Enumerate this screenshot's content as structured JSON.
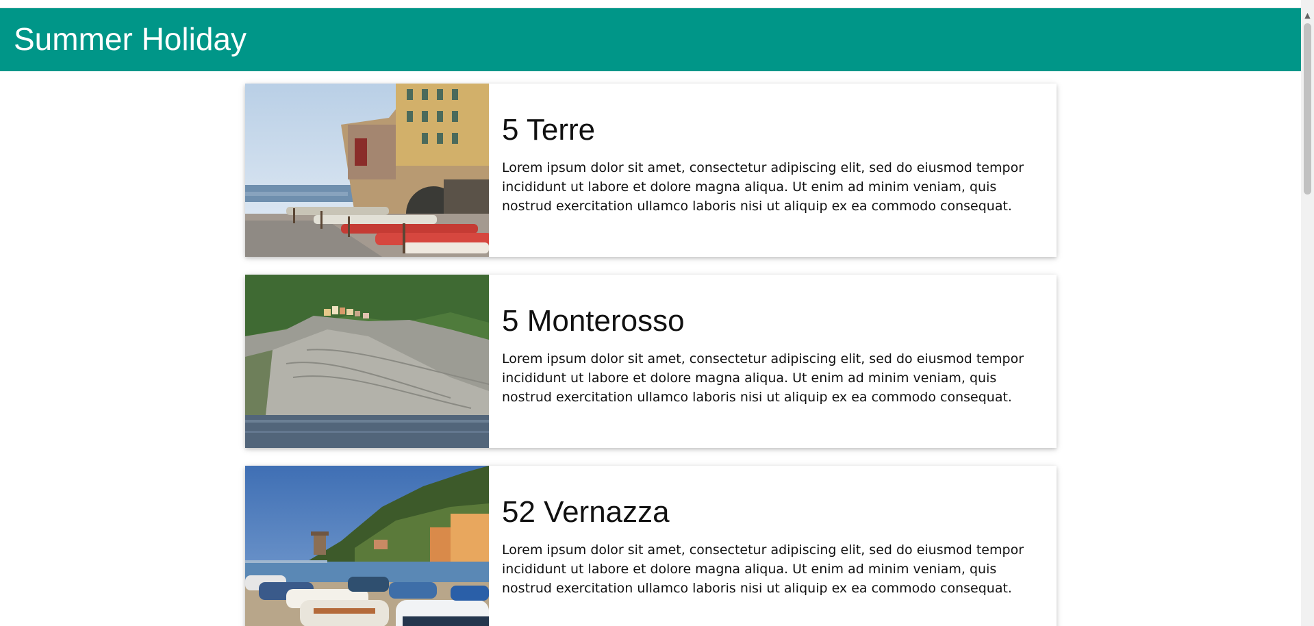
{
  "header": {
    "title": "Summer Holiday",
    "color": "#009688"
  },
  "cards": [
    {
      "title": "5 Terre",
      "text": "Lorem ipsum dolor sit amet, consectetur adipiscing elit, sed do eiusmod tempor incididunt ut labore et dolore magna aliqua. Ut enim ad minim veniam, quis nostrud exercitation ullamco laboris nisi ut aliquip ex ea commodo consequat."
    },
    {
      "title": "5 Monterosso",
      "text": "Lorem ipsum dolor sit amet, consectetur adipiscing elit, sed do eiusmod tempor incididunt ut labore et dolore magna aliqua. Ut enim ad minim veniam, quis nostrud exercitation ullamco laboris nisi ut aliquip ex ea commodo consequat."
    },
    {
      "title": "52 Vernazza",
      "text": "Lorem ipsum dolor sit amet, consectetur adipiscing elit, sed do eiusmod tempor incididunt ut labore et dolore magna aliqua. Ut enim ad minim veniam, quis nostrud exercitation ullamco laboris nisi ut aliquip ex ea commodo consequat."
    }
  ],
  "icons": {
    "scroll_up": "scroll-up-arrow-icon"
  }
}
